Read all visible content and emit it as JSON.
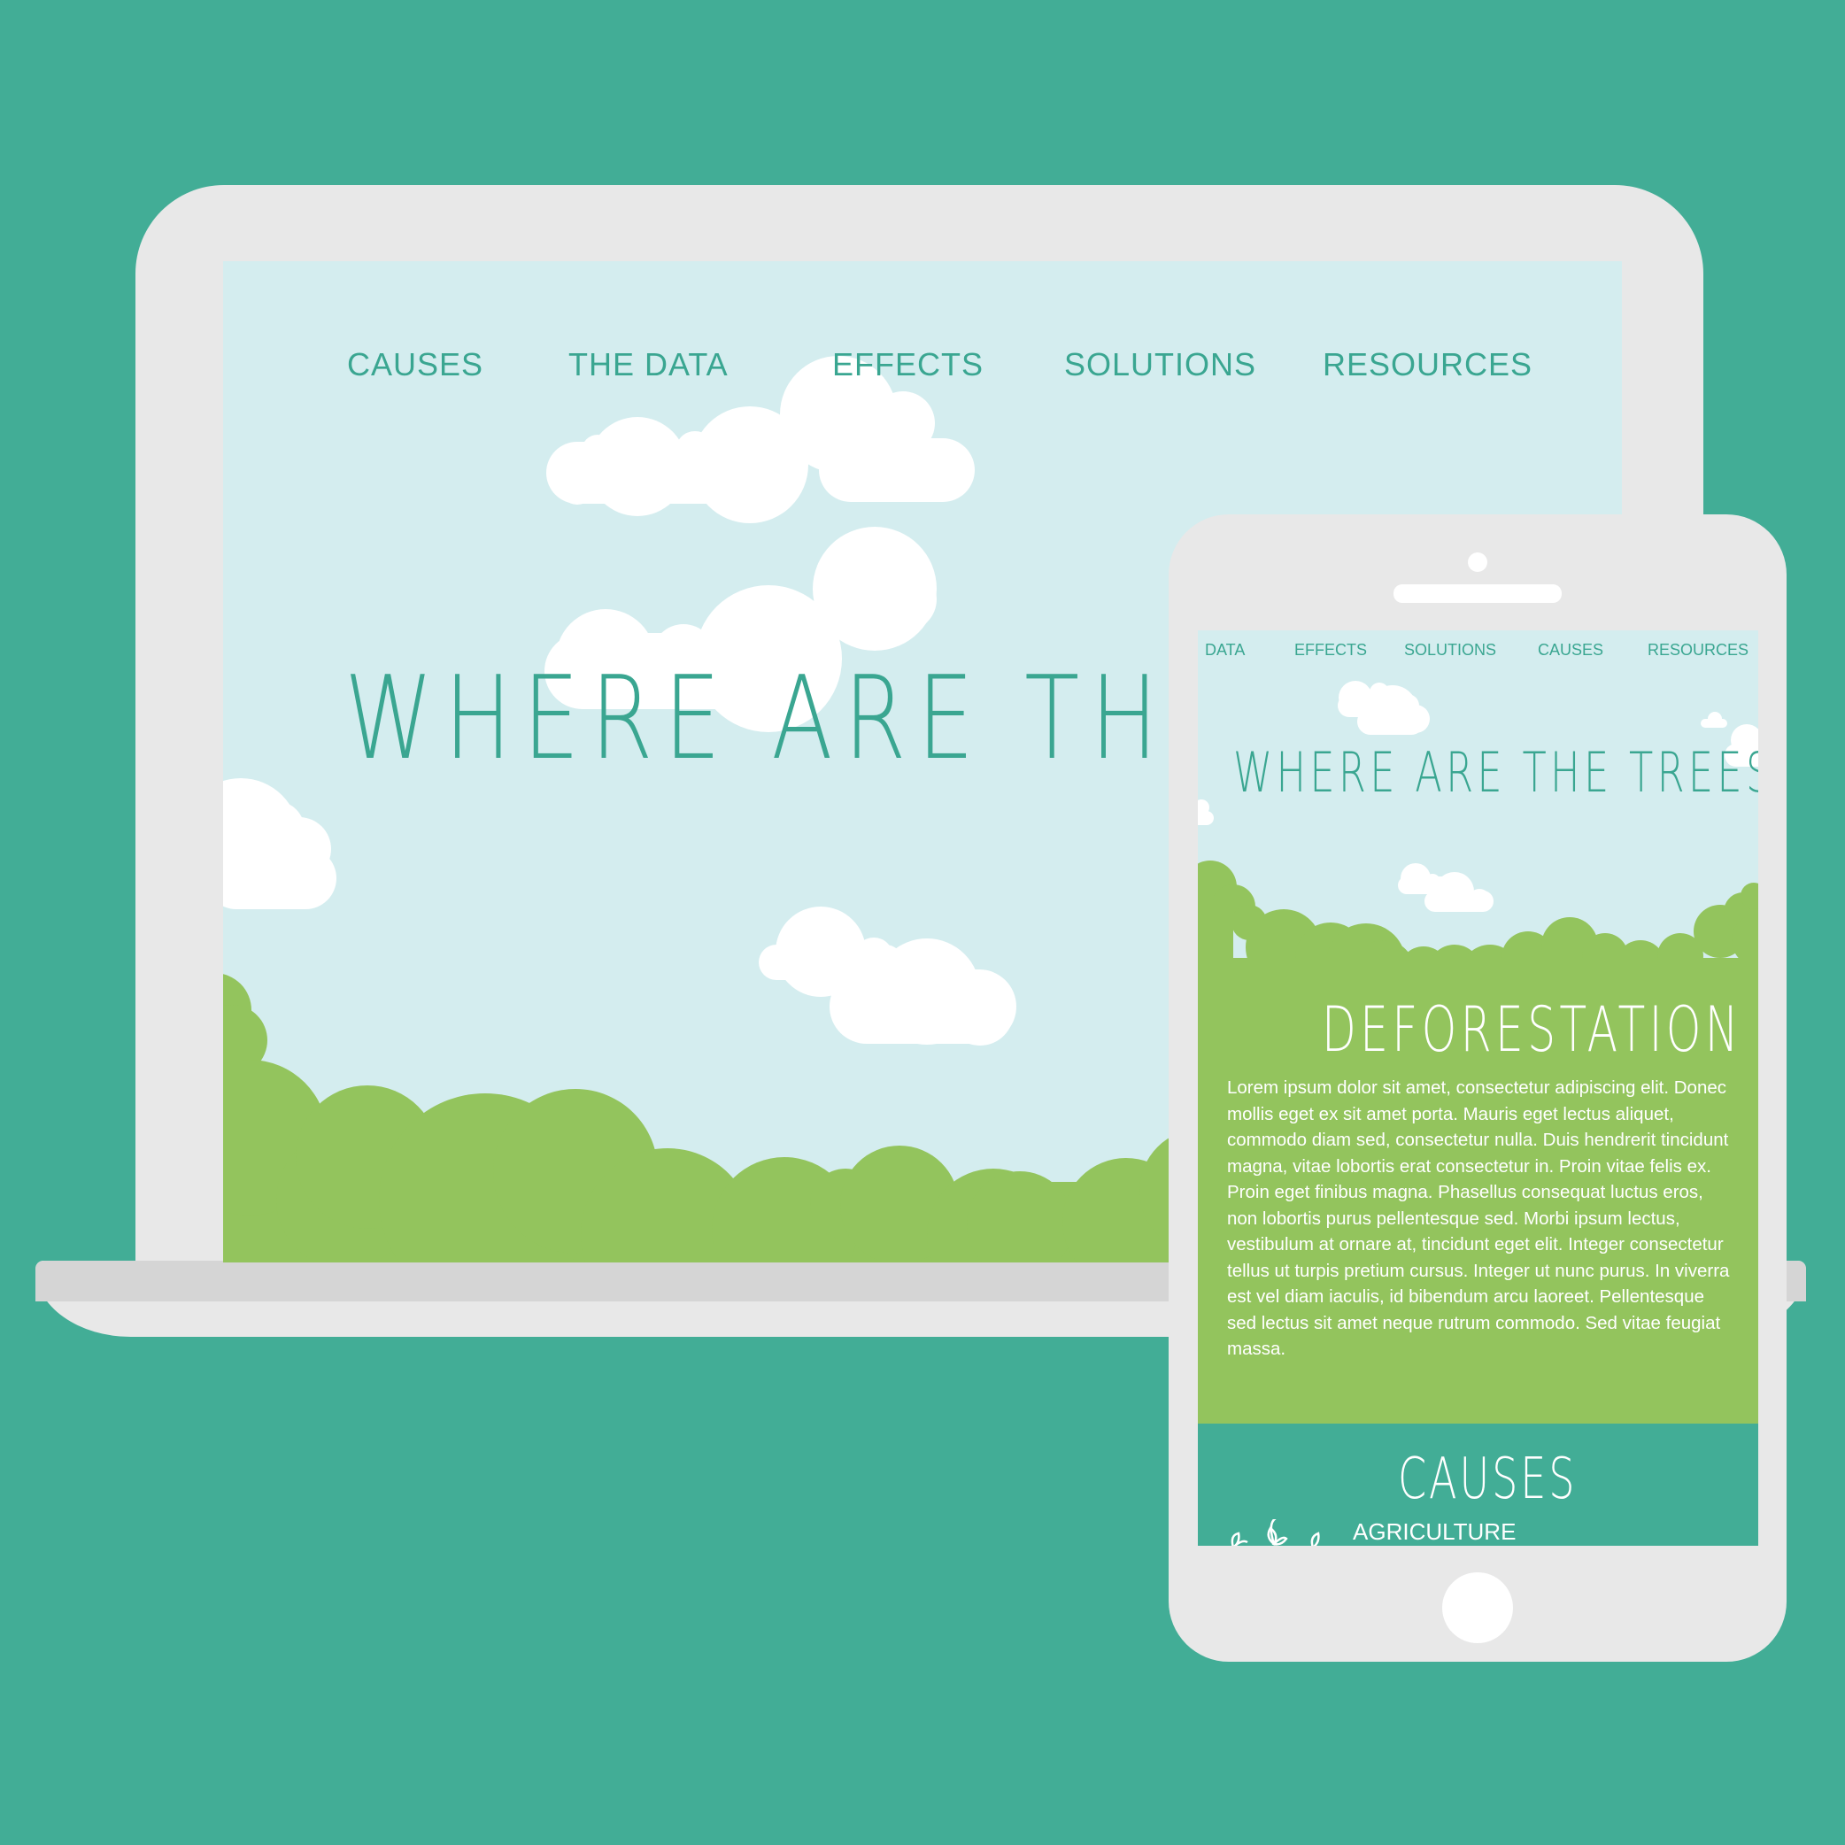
{
  "desktop": {
    "nav": [
      "CAUSES",
      "THE DATA",
      "EFFECTS",
      "SOLUTIONS",
      "RESOURCES"
    ],
    "hero_title": "WHERE ARE THE T"
  },
  "mobile": {
    "nav": [
      "DATA",
      "EFFECTS",
      "SOLUTIONS",
      "CAUSES",
      "RESOURCES"
    ],
    "hero_title": "WHERE ARE THE TREES?",
    "section_heading": "DEFORESTATION",
    "body_text": "Lorem ipsum dolor sit amet, consectetur adipiscing elit. Donec mollis eget ex sit amet porta. Mauris eget lectus aliquet, commodo diam sed, consectetur nulla. Duis hendrerit tincidunt magna, vitae lobortis erat consectetur in. Proin vitae felis ex. Proin eget finibus magna. Phasellus consequat luctus eros, non lobortis purus pellentesque sed. Morbi ipsum lectus, vestibulum at ornare at, tincidunt eget elit. Integer consectetur tellus ut turpis pretium cursus. Integer ut nunc purus. In viverra est vel diam iaculis, id bibendum arcu laoreet. Pellentesque sed lectus sit amet neque rutrum commodo. Sed vitae feugiat massa.",
    "causes_heading": "CAUSES",
    "cause_item": "AGRICULTURE"
  },
  "icons": [
    "cloud-icon",
    "tree-canopy-icon",
    "plant-icon"
  ],
  "colors": {
    "background": "#42ad96",
    "device_frame": "#e8e8e8",
    "sky": "#d4edef",
    "grass": "#93c45d",
    "accent_text": "#3aa691",
    "cloud": "#ffffff"
  }
}
